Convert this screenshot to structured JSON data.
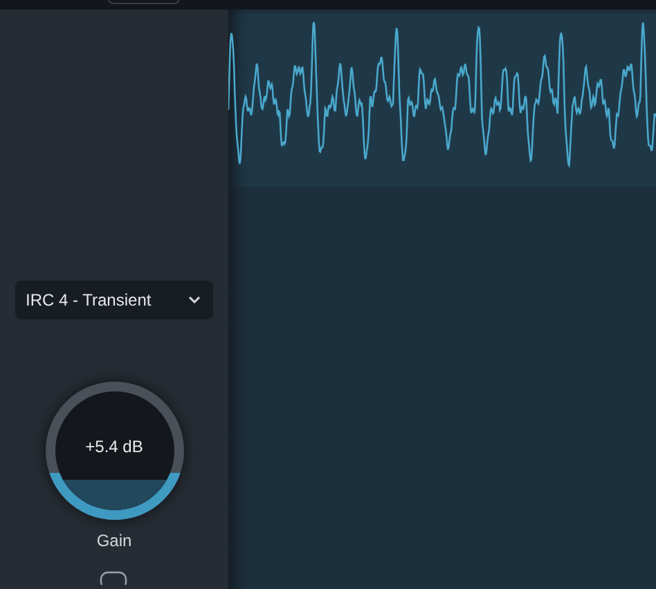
{
  "preset_dropdown": {
    "value": "IRC 4 - Transient"
  },
  "gain_knob": {
    "value": "+5.4 dB",
    "label": "Gain"
  }
}
